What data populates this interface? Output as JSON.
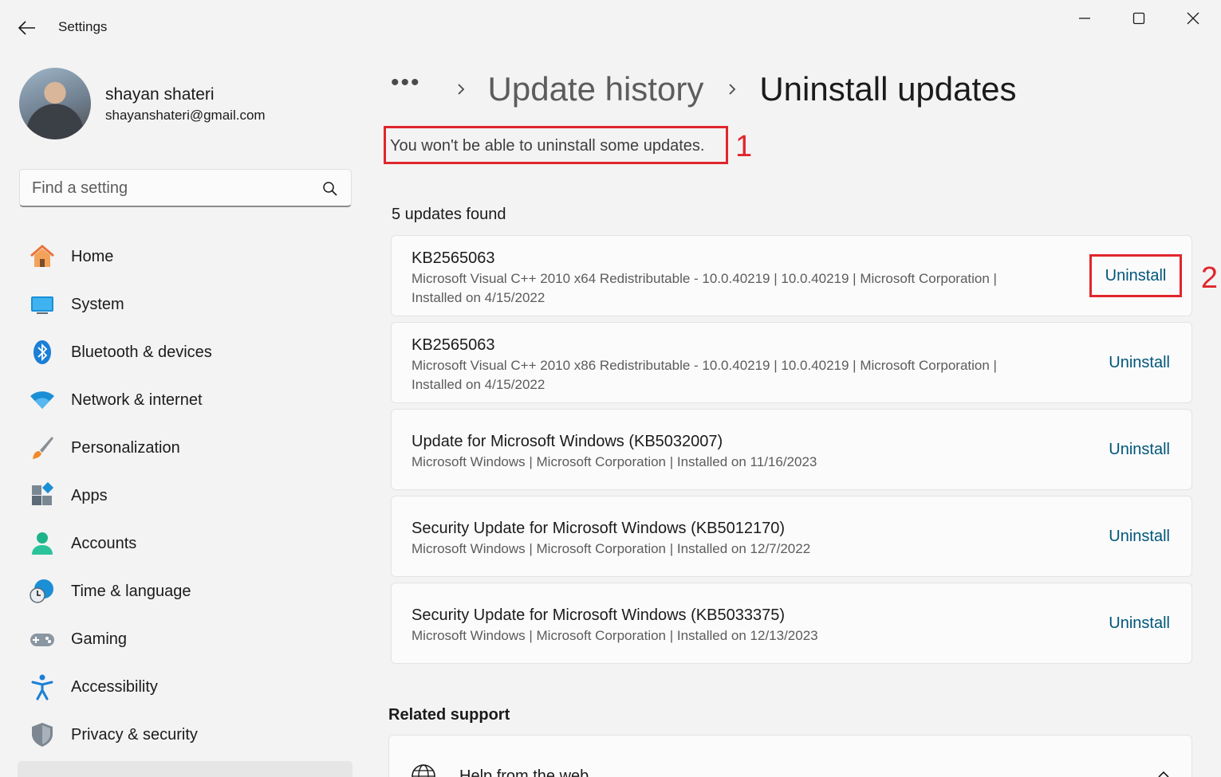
{
  "window": {
    "title": "Settings"
  },
  "profile": {
    "name": "shayan shateri",
    "email": "shayanshateri@gmail.com"
  },
  "search": {
    "placeholder": "Find a setting"
  },
  "sidebar": {
    "items": [
      {
        "label": "Home",
        "icon": "home-icon"
      },
      {
        "label": "System",
        "icon": "system-icon"
      },
      {
        "label": "Bluetooth & devices",
        "icon": "bluetooth-icon"
      },
      {
        "label": "Network & internet",
        "icon": "wifi-icon"
      },
      {
        "label": "Personalization",
        "icon": "brush-icon"
      },
      {
        "label": "Apps",
        "icon": "apps-icon"
      },
      {
        "label": "Accounts",
        "icon": "account-icon"
      },
      {
        "label": "Time & language",
        "icon": "clock-globe-icon"
      },
      {
        "label": "Gaming",
        "icon": "gamepad-icon"
      },
      {
        "label": "Accessibility",
        "icon": "accessibility-icon"
      },
      {
        "label": "Privacy & security",
        "icon": "shield-icon"
      }
    ]
  },
  "breadcrumb": {
    "more": "•••",
    "parent": "Update history",
    "current": "Uninstall updates"
  },
  "notice": {
    "text": "You won't be able to uninstall some updates."
  },
  "annotations": {
    "first": "1",
    "second": "2"
  },
  "updates": {
    "count_label": "5 updates found",
    "button_label": "Uninstall",
    "items": [
      {
        "title": "KB2565063",
        "line1": "Microsoft Visual C++ 2010  x64 Redistributable - 10.0.40219   |   10.0.40219   |   Microsoft Corporation   |",
        "line2": "Installed on 4/15/2022"
      },
      {
        "title": "KB2565063",
        "line1": "Microsoft Visual C++ 2010  x86 Redistributable - 10.0.40219   |   10.0.40219   |   Microsoft Corporation   |",
        "line2": "Installed on 4/15/2022"
      },
      {
        "title": "Update for Microsoft Windows (KB5032007)",
        "line1": "Microsoft Windows   |   Microsoft Corporation   |   Installed on 11/16/2023"
      },
      {
        "title": "Security Update for Microsoft Windows (KB5012170)",
        "line1": "Microsoft Windows   |   Microsoft Corporation   |   Installed on 12/7/2022"
      },
      {
        "title": "Security Update for Microsoft Windows (KB5033375)",
        "line1": "Microsoft Windows   |   Microsoft Corporation   |   Installed on 12/13/2023"
      }
    ]
  },
  "related": {
    "heading": "Related support",
    "help_label": "Help from the web"
  },
  "colors": {
    "accent": "#00567a",
    "annotation": "#e0262c"
  }
}
